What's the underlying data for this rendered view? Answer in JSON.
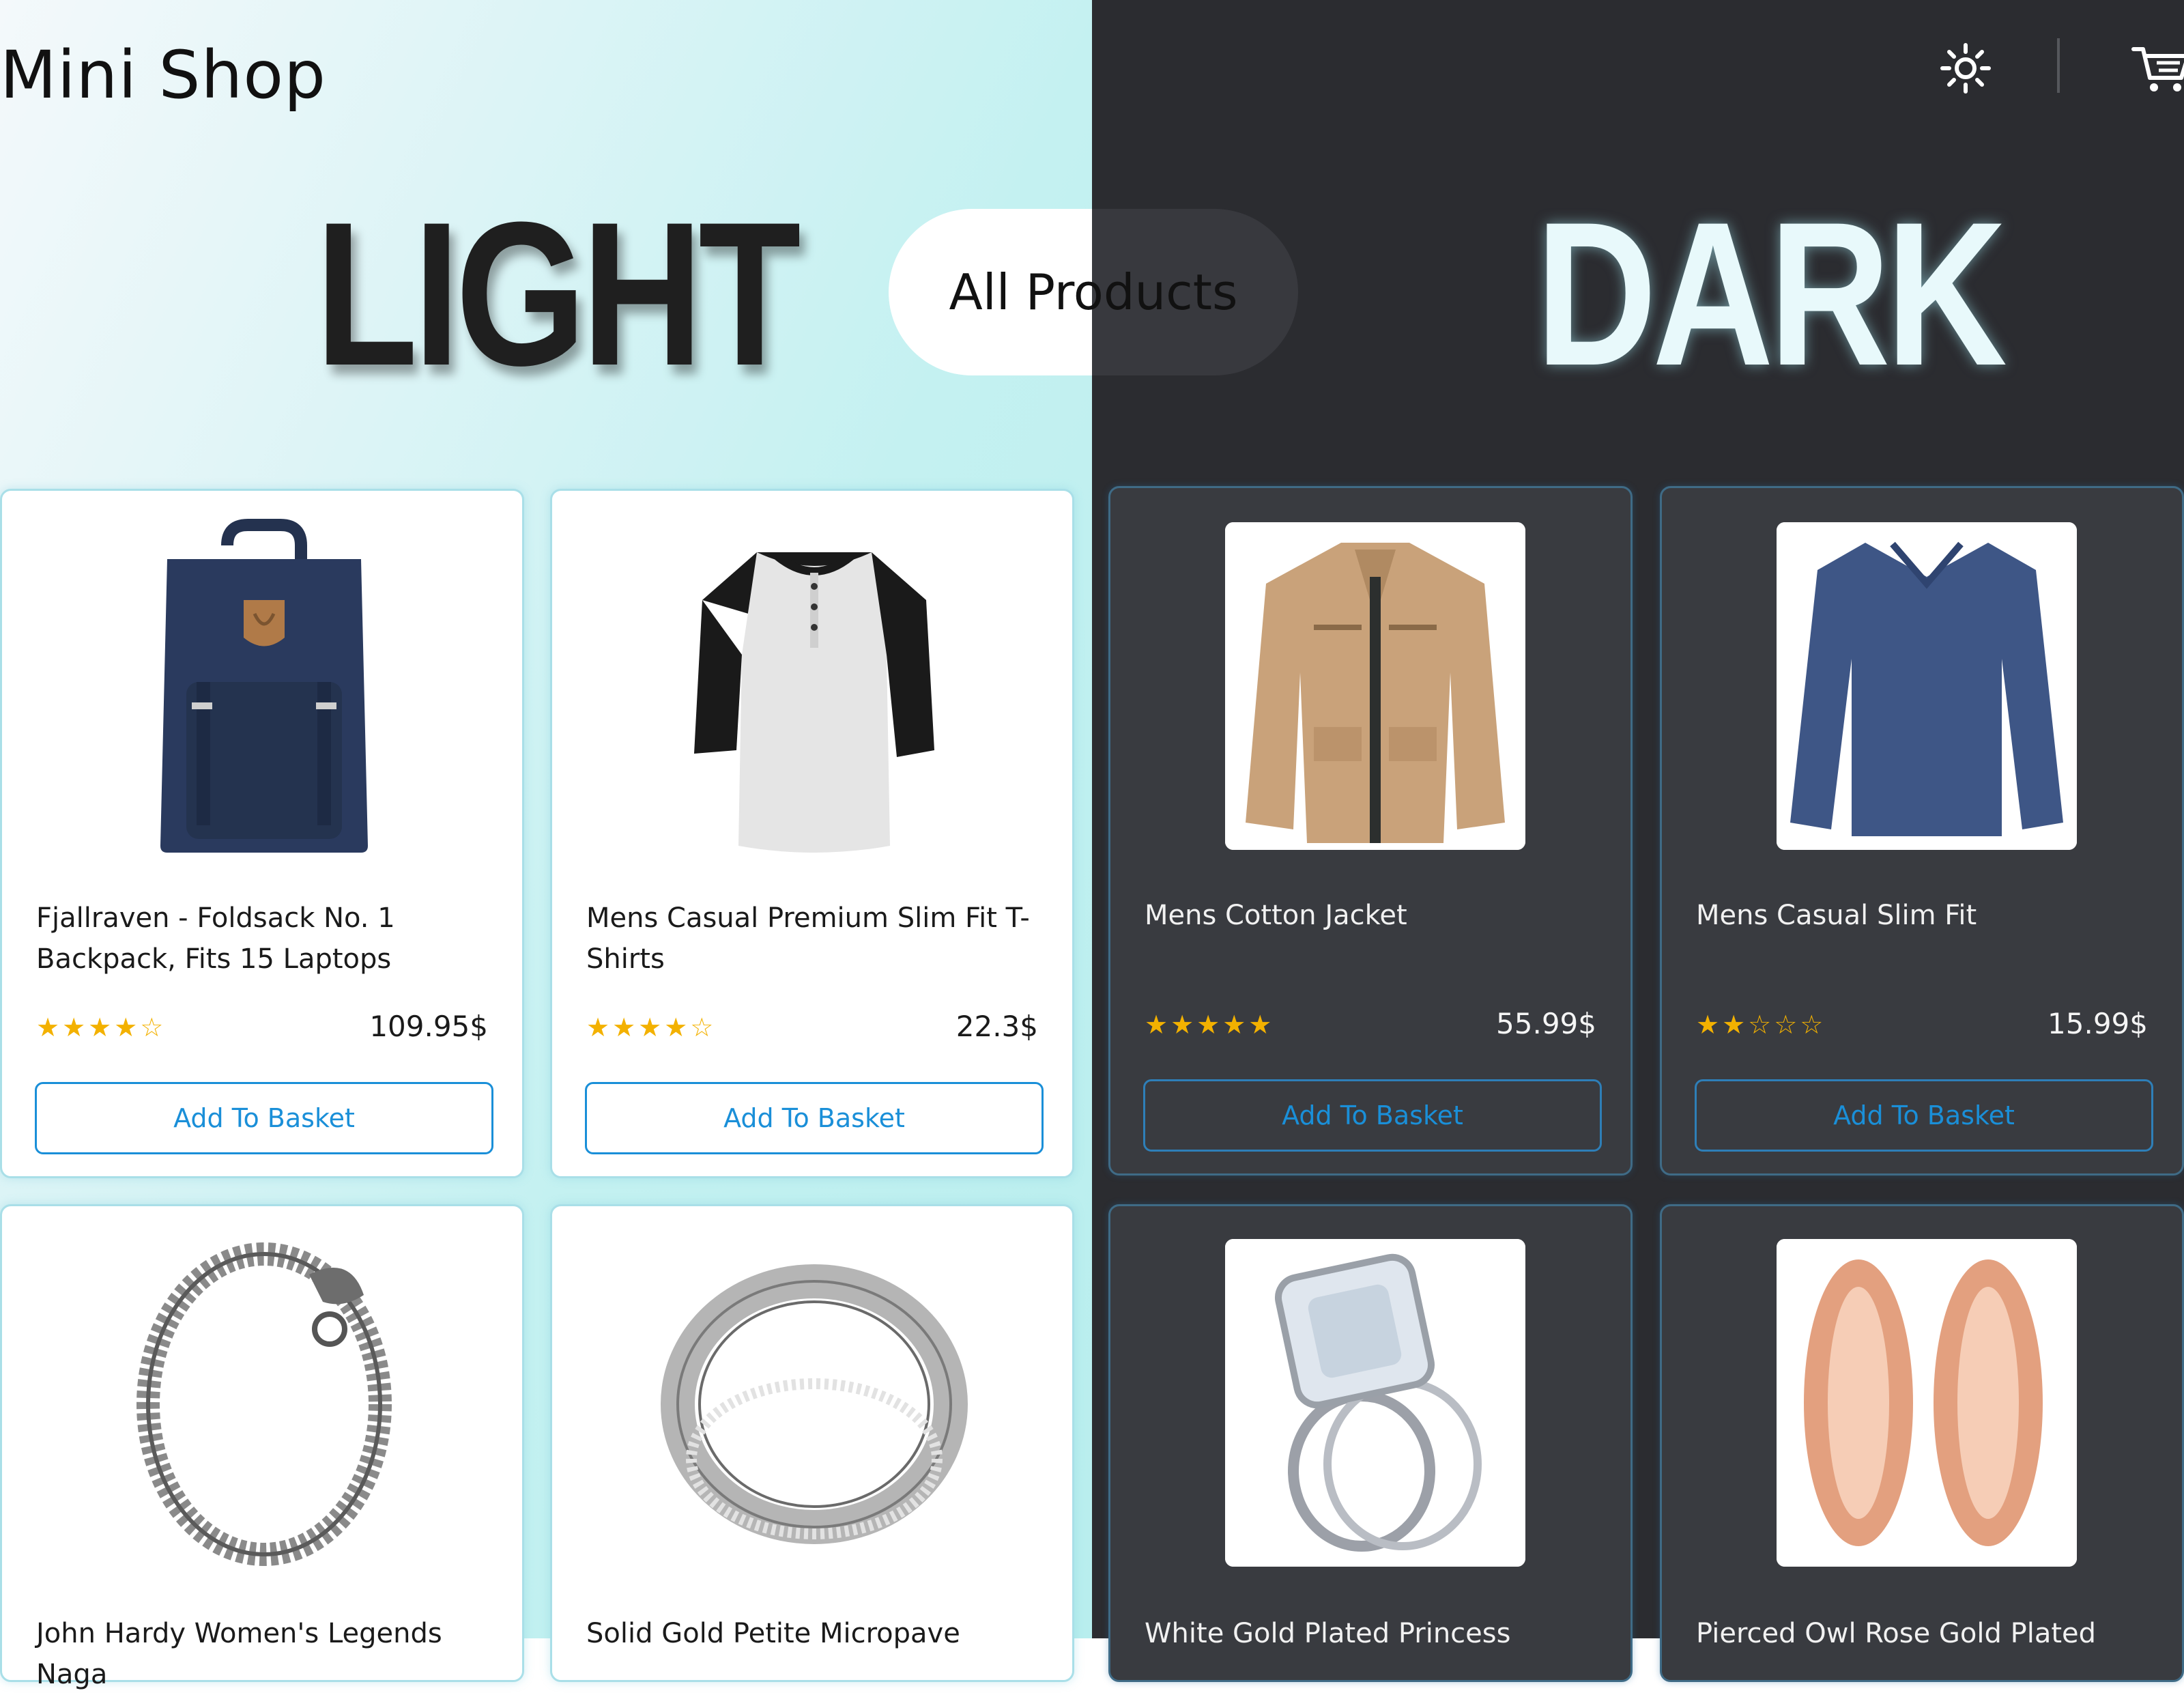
{
  "header": {
    "brand": "Mini Shop",
    "theme_icon": "sun-icon",
    "cart_icon": "cart-icon"
  },
  "banner": {
    "light_word": "LIGHT",
    "dark_word": "DARK",
    "category_pill": "All Products"
  },
  "colors": {
    "accent": "#1a8fd8",
    "star": "#f3b100",
    "dark_bg": "#2b2c30",
    "light_bg": "#c4f1f1"
  },
  "products": [
    {
      "name": "Fjallraven - Foldsack No. 1 Backpack, Fits 15 Laptops",
      "price": "109.95$",
      "rating": 4,
      "rating_text": "★★★★☆",
      "button": "Add To Basket",
      "image": "backpack"
    },
    {
      "name": "Mens Casual Premium Slim Fit T-Shirts",
      "price": "22.3$",
      "rating": 4,
      "rating_text": "★★★★☆",
      "button": "Add To Basket",
      "image": "tshirt"
    },
    {
      "name": "Mens Cotton Jacket",
      "price": "55.99$",
      "rating": 5,
      "rating_text": "★★★★★",
      "button": "Add To Basket",
      "image": "jacket"
    },
    {
      "name": "Mens Casual Slim Fit",
      "price": "15.99$",
      "rating": 2,
      "rating_text": "★★☆☆☆",
      "button": "Add To Basket",
      "image": "longsleeve"
    },
    {
      "name": "John Hardy Women's Legends Naga",
      "image": "bracelet"
    },
    {
      "name": "Solid Gold Petite Micropave",
      "image": "ring"
    },
    {
      "name": "White Gold Plated Princess",
      "image": "ring-set"
    },
    {
      "name": "Pierced Owl Rose Gold Plated",
      "image": "rose-gold-plugs"
    }
  ]
}
